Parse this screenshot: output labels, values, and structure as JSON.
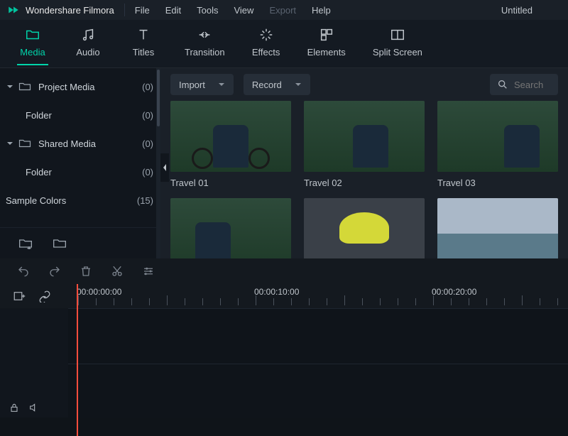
{
  "app": {
    "name": "Wondershare Filmora",
    "document": "Untitled"
  },
  "menu": {
    "file": "File",
    "edit": "Edit",
    "tools": "Tools",
    "view": "View",
    "export": "Export",
    "help": "Help"
  },
  "tabs": {
    "media": "Media",
    "audio": "Audio",
    "titles": "Titles",
    "transition": "Transition",
    "effects": "Effects",
    "elements": "Elements",
    "split": "Split Screen"
  },
  "sidebar": {
    "project": {
      "label": "Project Media",
      "count": "(0)"
    },
    "project_folder": {
      "label": "Folder",
      "count": "(0)"
    },
    "shared": {
      "label": "Shared Media",
      "count": "(0)"
    },
    "shared_folder": {
      "label": "Folder",
      "count": "(0)"
    },
    "sample": {
      "label": "Sample Colors",
      "count": "(15)"
    }
  },
  "browser": {
    "import": "Import",
    "record": "Record",
    "search_placeholder": "Search",
    "clips": {
      "c1": "Travel 01",
      "c2": "Travel 02",
      "c3": "Travel 03"
    }
  },
  "timeline": {
    "t0": "00:00:00:00",
    "t1": "00:00:10:00",
    "t2": "00:00:20:00"
  }
}
